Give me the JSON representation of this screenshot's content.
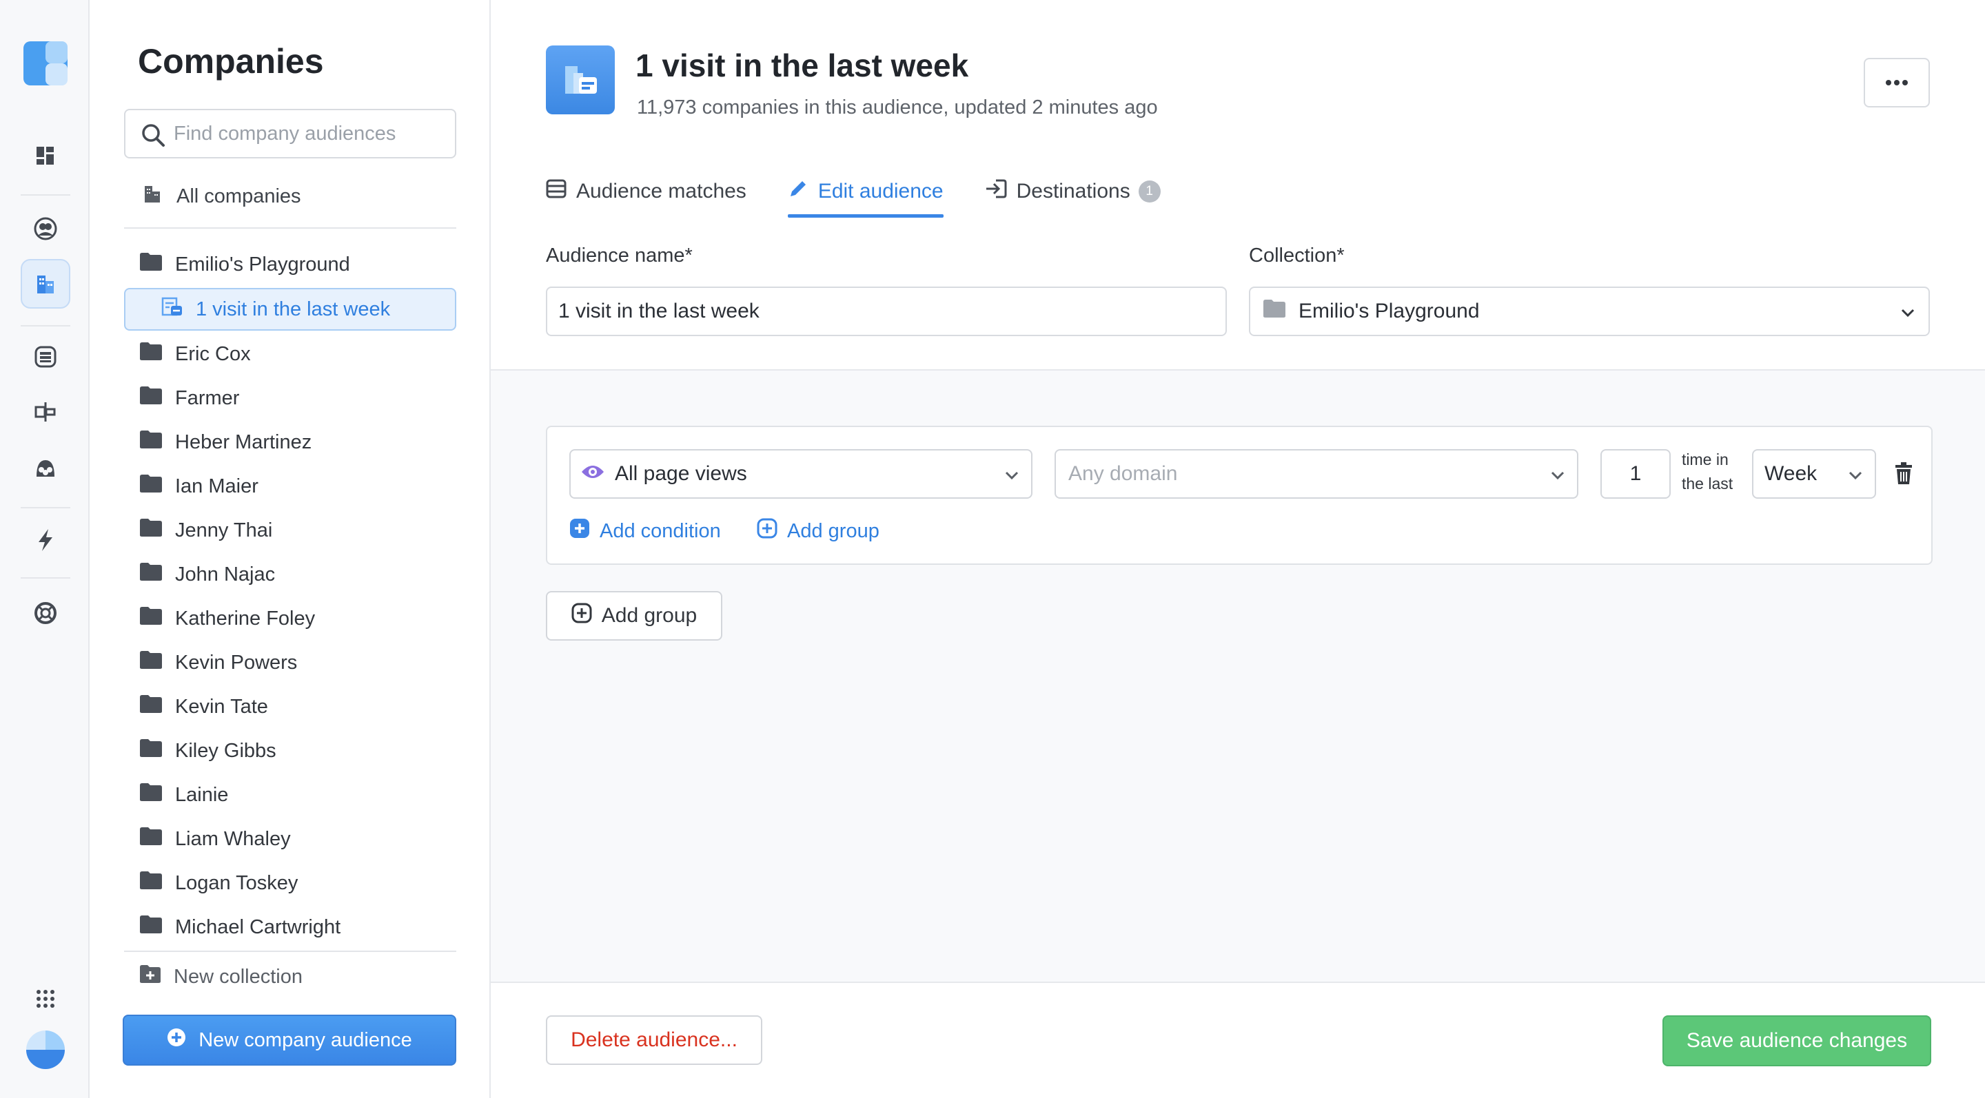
{
  "sidebar": {
    "title": "Companies",
    "search_placeholder": "Find company audiences",
    "all_companies": "All companies",
    "collections": [
      {
        "label": "Emilio's Playground"
      },
      {
        "label": "1 visit in the last week",
        "child": true
      },
      {
        "label": "Eric Cox"
      },
      {
        "label": "Farmer"
      },
      {
        "label": "Heber Martinez"
      },
      {
        "label": "Ian Maier"
      },
      {
        "label": "Jenny Thai"
      },
      {
        "label": "John Najac"
      },
      {
        "label": "Katherine Foley"
      },
      {
        "label": "Kevin Powers"
      },
      {
        "label": "Kevin Tate"
      },
      {
        "label": "Kiley Gibbs"
      },
      {
        "label": "Lainie"
      },
      {
        "label": "Liam Whaley"
      },
      {
        "label": "Logan Toskey"
      },
      {
        "label": "Michael Cartwright"
      }
    ],
    "new_collection": "New collection",
    "new_audience_button": "New company audience"
  },
  "header": {
    "title": "1 visit in the last week",
    "subtitle": "11,973 companies in this audience, updated 2 minutes ago",
    "more_label": "•••"
  },
  "tabs": [
    {
      "label": "Audience matches"
    },
    {
      "label": "Edit audience"
    },
    {
      "label": "Destinations",
      "badge": "1"
    }
  ],
  "form": {
    "audience_name_label": "Audience name*",
    "audience_name_value": "1 visit in the last week",
    "collection_label": "Collection*",
    "collection_value": "Emilio's Playground"
  },
  "condition": {
    "event": "All page views",
    "domain_placeholder": "Any domain",
    "count": "1",
    "time_text_1": "time in",
    "time_text_2": "the last",
    "period": "Week",
    "add_condition": "Add condition",
    "add_group_inner": "Add group"
  },
  "add_group_outer": "Add group",
  "footer": {
    "delete": "Delete audience...",
    "save": "Save audience changes"
  },
  "colors": {
    "accent": "#3a86e6",
    "save": "#5cc778",
    "danger": "#d9321f",
    "event_icon": "#8b6fe0"
  }
}
